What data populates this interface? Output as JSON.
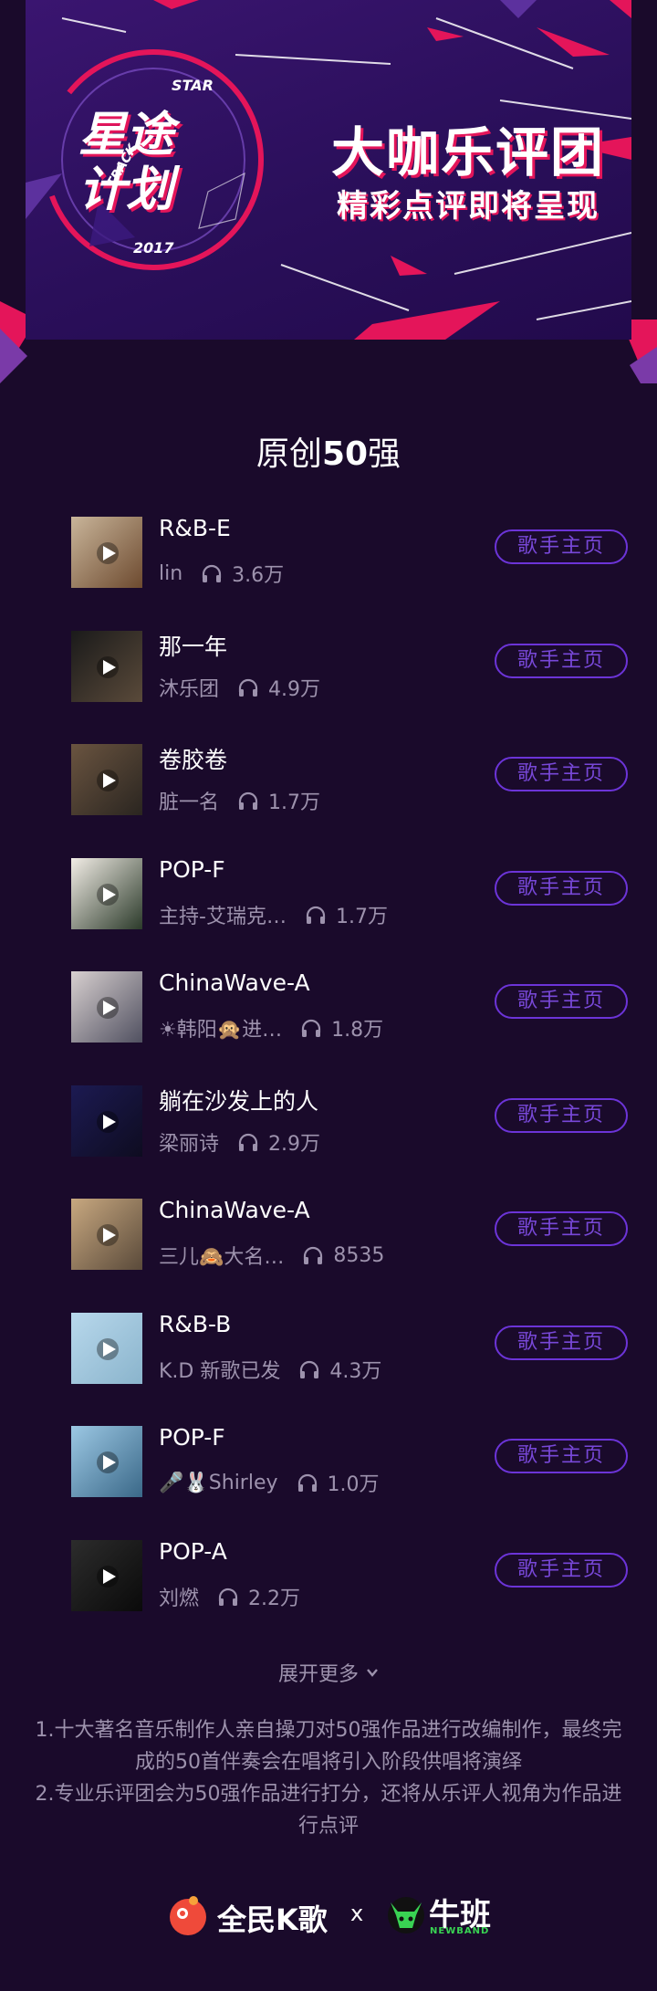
{
  "banner": {
    "logo_main": "星途计划",
    "logo_star": "STAR",
    "logo_track": "TRACK",
    "logo_year": "2017",
    "headline": "大咖乐评团",
    "subhead": "精彩点评即将呈现"
  },
  "section": {
    "title_prefix": "原创",
    "title_num": "50",
    "title_suffix": "强"
  },
  "button_label": "歌手主页",
  "songs": [
    {
      "title": "R&B-E",
      "singer": "lin",
      "plays": "3.6万",
      "thumb": [
        "#c9b59a",
        "#6d4a2f"
      ]
    },
    {
      "title": "那一年",
      "singer": "沐乐团",
      "plays": "4.9万",
      "thumb": [
        "#1a1a1a",
        "#5a4a3a"
      ]
    },
    {
      "title": "卷胶卷",
      "singer": "脏一名",
      "plays": "1.7万",
      "thumb": [
        "#6a5440",
        "#2a2520"
      ]
    },
    {
      "title": "POP-F",
      "singer": "主持-艾瑞克…",
      "plays": "1.7万",
      "thumb": [
        "#f2ede6",
        "#2b3a2a"
      ]
    },
    {
      "title": "ChinaWave-A",
      "singer": "☀韩阳🙊进…",
      "plays": "1.8万",
      "thumb": [
        "#d8d0d0",
        "#505060"
      ]
    },
    {
      "title": "躺在沙发上的人",
      "singer": "梁丽诗",
      "plays": "2.9万",
      "thumb": [
        "#1c1a52",
        "#0e0c20"
      ]
    },
    {
      "title": "ChinaWave-A",
      "singer": "三儿🙈大名…",
      "plays": "8535",
      "thumb": [
        "#c8a880",
        "#5a4a3a"
      ]
    },
    {
      "title": "R&B-B",
      "singer": "K.D 新歌已发",
      "plays": "4.3万",
      "thumb": [
        "#b8d8ec",
        "#8ab4cc"
      ]
    },
    {
      "title": "POP-F",
      "singer": "🎤🐰Shirley",
      "plays": "1.0万",
      "thumb": [
        "#9cc8e4",
        "#3a6888"
      ]
    },
    {
      "title": "POP-A",
      "singer": "刘燃",
      "plays": "2.2万",
      "thumb": [
        "#2c2c2c",
        "#0a0a0a"
      ]
    }
  ],
  "expand_label": "展开更多",
  "notes": [
    "1.十大著名音乐制作人亲自操刀对50强作品进行改编制作，最终完成的50首伴奏会在唱将引入阶段供唱将演绎",
    "2.专业乐评团会为50强作品进行打分，还将从乐评人视角为作品进行点评"
  ],
  "footer": {
    "brand1": "全民K歌",
    "times": "x",
    "brand2": "牛班",
    "brand2_sub": "NEWBAND"
  },
  "colors": {
    "background": "#1a0a2b",
    "accent": "#e4155a",
    "button_border": "#6c34d8",
    "muted_text": "#9d92ad"
  },
  "icons": [
    "play-icon",
    "headphones-icon",
    "chevron-down-icon",
    "kge-logo-icon",
    "newband-logo-icon"
  ]
}
